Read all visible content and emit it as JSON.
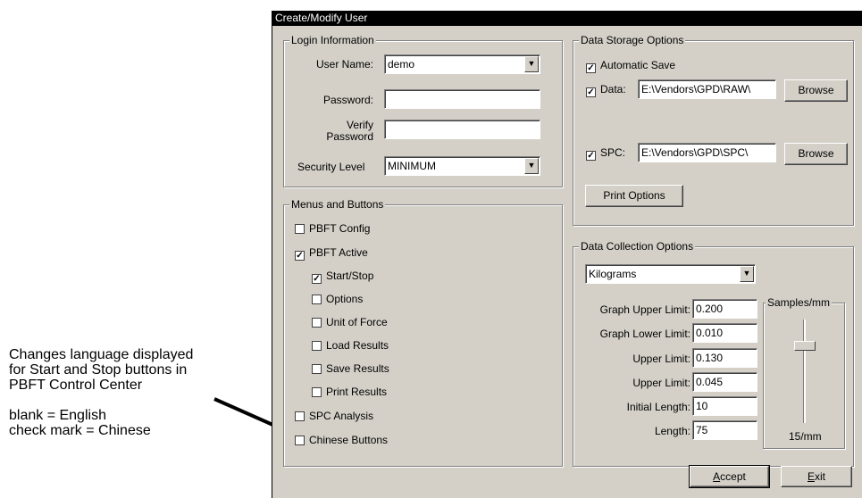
{
  "annotation": {
    "lines": [
      "Changes language displayed",
      "for Start and Stop buttons in",
      "PBFT Control Center",
      "",
      "blank = English",
      "check mark = Chinese"
    ]
  },
  "window": {
    "title": "Create/Modify User"
  },
  "login": {
    "legend": "Login Information",
    "user_name_label": "User Name:",
    "user_name_value": "demo",
    "password_label": "Password:",
    "password_value": "",
    "verify_label_1": "Verify",
    "verify_label_2": "Password",
    "verify_value": "",
    "security_label": "Security Level",
    "security_value": "MINIMUM"
  },
  "menus": {
    "legend": "Menus and Buttons",
    "items": [
      {
        "label": "PBFT Config",
        "checked": false
      },
      {
        "label": "PBFT Active",
        "checked": true
      },
      {
        "label": "Start/Stop",
        "checked": true
      },
      {
        "label": "Options",
        "checked": false
      },
      {
        "label": "Unit of Force",
        "checked": false
      },
      {
        "label": "Load Results",
        "checked": false
      },
      {
        "label": "Save Results",
        "checked": false
      },
      {
        "label": "Print Results",
        "checked": false
      },
      {
        "label": "SPC Analysis",
        "checked": false
      },
      {
        "label": "Chinese Buttons",
        "checked": false
      }
    ]
  },
  "storage": {
    "legend": "Data Storage Options",
    "auto_save_label": "Automatic Save",
    "auto_save_checked": true,
    "data_label": "Data:",
    "data_checked": true,
    "data_path": "E:\\Vendors\\GPD\\RAW\\",
    "spc_label": "SPC:",
    "spc_checked": true,
    "spc_path": "E:\\Vendors\\GPD\\SPC\\",
    "browse_label": "Browse",
    "print_options_label": "Print Options"
  },
  "collection": {
    "legend": "Data Collection Options",
    "unit_value": "Kilograms",
    "fields": [
      {
        "label": "Graph Upper Limit:",
        "value": "0.200"
      },
      {
        "label": "Graph Lower Limit:",
        "value": "0.010"
      },
      {
        "label": "Upper Limit:",
        "value": "0.130"
      },
      {
        "label": "Upper Limit:",
        "value": "0.045"
      },
      {
        "label": "Initial Length:",
        "value": "10"
      },
      {
        "label": "Length:",
        "value": "75"
      }
    ],
    "samples_legend": "Samples/mm",
    "samples_value": "15/mm"
  },
  "buttons": {
    "accept": "Accept",
    "accept_key": "A",
    "accept_rest": "ccept",
    "exit_key": "E",
    "exit_rest": "xit"
  },
  "colors": {
    "dialog_bg": "#d4d0c8",
    "title_bg": "#000000"
  }
}
